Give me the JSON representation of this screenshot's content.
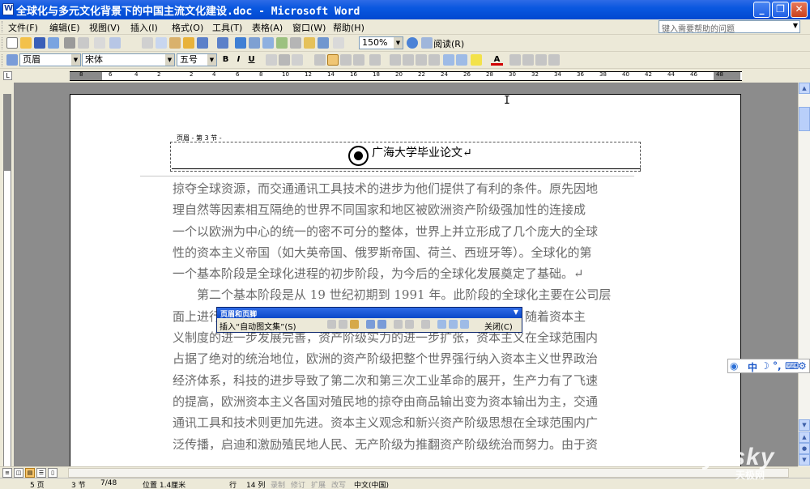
{
  "window": {
    "title": "全球化与多元文化背景下的中国主流文化建设.doc - Microsoft Word",
    "minimize_glyph": "_",
    "restore_glyph": "❐",
    "close_glyph": "✕"
  },
  "menu": {
    "items": [
      "文件(F)",
      "编辑(E)",
      "视图(V)",
      "插入(I)",
      "格式(O)",
      "工具(T)",
      "表格(A)",
      "窗口(W)",
      "帮助(H)"
    ],
    "help_placeholder": "键入需要帮助的问题"
  },
  "standard_toolbar": {
    "zoom": "150%",
    "read_label": "阅读(R)"
  },
  "format_toolbar": {
    "style": "页眉",
    "font": "宋体",
    "size": "五号",
    "bold": "B",
    "italic": "I",
    "underline": "U",
    "font_color_label": "A"
  },
  "ruler": {
    "numbers": [
      "8",
      "6",
      "4",
      "2",
      "2",
      "4",
      "6",
      "8",
      "10",
      "12",
      "14",
      "16",
      "18",
      "20",
      "22",
      "24",
      "26",
      "28",
      "30",
      "32",
      "34",
      "36",
      "38",
      "40",
      "42",
      "44",
      "46",
      "48"
    ],
    "corner_glyph": "L"
  },
  "document": {
    "header_label": "页眉 - 第 3 节 -",
    "header_title": "广海大学毕业论文",
    "header_mark": "↵",
    "body_lines": [
      "掠夺全球资源，而交通通讯工具技术的进步为他们提供了有利的条件。原先因地",
      "理自然等因素相互隔绝的世界不同国家和地区被欧洲资产阶级强加性的连接成",
      "一个以欧洲为中心的统一的密不可分的整体，世界上并立形成了几个庞大的全球",
      "性的资本主义帝国（如大英帝国、俄罗斯帝国、荷兰、西班牙等）。全球化的第",
      "一个基本阶段是全球化进程的初步阶段，为今后的全球化发展奠定了基础。↵",
      "　　第二个基本阶段是从 19 世纪初期到 1991 年。此阶段的全球化主要在公司层",
      "面上进行　　　　　　　　　　　　　　　　　　　　　的地位。随着资本主",
      "义制度的进一步发展完善，资产阶级实力的进一步扩张，资本主义在全球范围内",
      "占据了绝对的统治地位，欧洲的资产阶级把整个世界强行纳入资本主义世界政治",
      "经济体系，科技的进步导致了第二次和第三次工业革命的展开，生产力有了飞速",
      "的提高，欧洲资本主义各国对殖民地的掠夺由商品输出变为资本输出为主，交通",
      "通讯工具和技术则更加先进。资本主义观念和新兴资产阶级思想在全球范围内广",
      "泛传播，启迪和激励殖民地人民、无产阶级为推翻资产阶级统治而努力。由于资"
    ]
  },
  "hf_toolbar": {
    "caption": "页眉和页脚",
    "insert_autotext": "插入“自动图文集”(S)",
    "close": "关闭(C)"
  },
  "ime": {
    "items": [
      "中",
      "☽",
      "°,",
      "⌨",
      "⚙"
    ]
  },
  "status": {
    "page": "5 页",
    "section": "3 节",
    "pages": "7/48",
    "position": "位置 1.4厘米",
    "line": "行",
    "col": "14 列",
    "rec": "录制",
    "trk": "修订",
    "ext": "扩展",
    "ovr": "改写",
    "lang": "中文(中国)"
  },
  "watermark": {
    "logo": "yesky",
    "sub": "天极网"
  }
}
